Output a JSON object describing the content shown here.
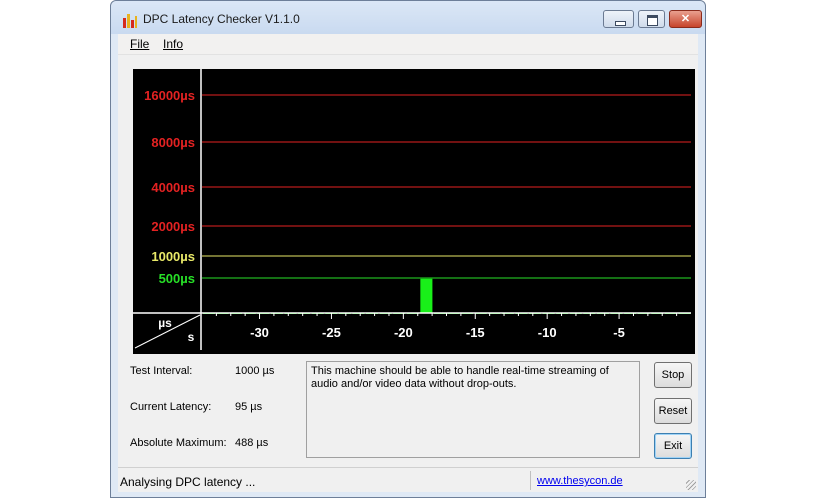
{
  "window": {
    "title": "DPC Latency Checker V1.1.0",
    "controls": {
      "minimize": "minimize",
      "maximize": "maximize",
      "close": "✕"
    }
  },
  "menu": {
    "file": "File",
    "info": "Info"
  },
  "chart_data": {
    "type": "bar",
    "ylabel": "µs",
    "xlabel": "s",
    "y_ticks": [
      {
        "label": "16000µs",
        "color": "#e32222"
      },
      {
        "label": "8000µs",
        "color": "#e32222"
      },
      {
        "label": "4000µs",
        "color": "#e32222"
      },
      {
        "label": "2000µs",
        "color": "#e32222"
      },
      {
        "label": "1000µs",
        "color": "#e8e868"
      },
      {
        "label": "500µs",
        "color": "#27e027"
      }
    ],
    "x_ticks": [
      "-30",
      "-25",
      "-20",
      "-15",
      "-10",
      "-5"
    ],
    "x_range": [
      -34,
      0
    ],
    "bar_color": "#19f019",
    "values": [
      130,
      80,
      80,
      80,
      80,
      80,
      70,
      80,
      110,
      90,
      90,
      90,
      90,
      80,
      90,
      70,
      488,
      150,
      80,
      80,
      80,
      90,
      90,
      80,
      80,
      80,
      80,
      80,
      80,
      80,
      80,
      80,
      80,
      70,
      80,
      80
    ]
  },
  "info": {
    "test_interval_label": "Test Interval:",
    "test_interval_value": "1000 µs",
    "current_latency_label": "Current Latency:",
    "current_latency_value": "95 µs",
    "absolute_maximum_label": "Absolute Maximum:",
    "absolute_maximum_value": "488 µs"
  },
  "message": "This machine should be able to handle real-time streaming of audio and/or video data without drop-outs.",
  "buttons": {
    "stop": "Stop",
    "reset": "Reset",
    "exit": "Exit"
  },
  "status": {
    "text": "Analysing DPC latency ...",
    "link": "www.thesycon.de"
  }
}
